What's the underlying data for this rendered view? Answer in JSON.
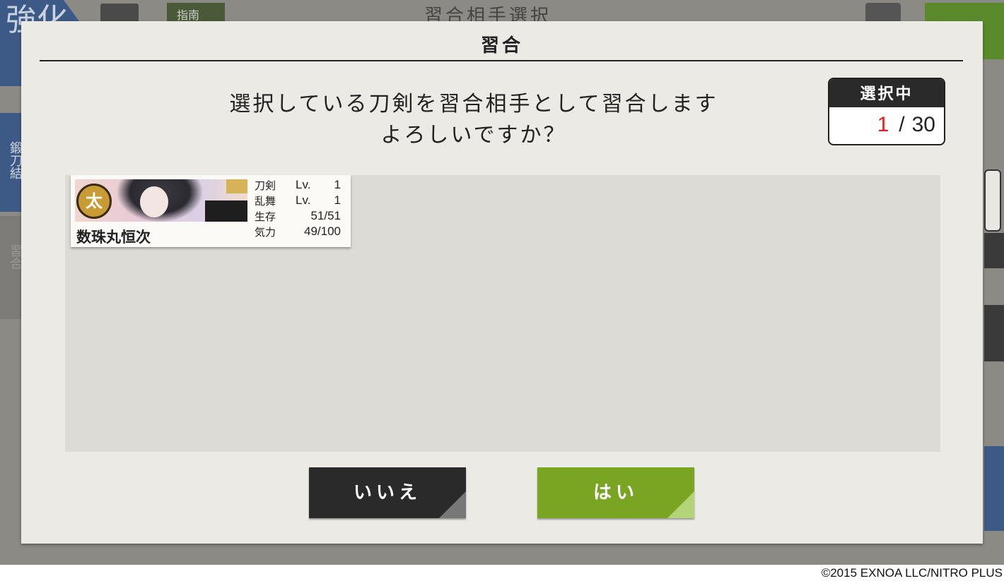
{
  "background": {
    "top_title": "習合相手選択",
    "guide_label": "指南",
    "left_badge_text": "強化",
    "side_tab_1": "鍛刀結",
    "side_tab_2": "習合"
  },
  "dialog": {
    "title": "習合",
    "message_line1": "選択している刀剣を習合相手として習合します",
    "message_line2": "よろしいですか？"
  },
  "selection_counter": {
    "header": "選択中",
    "current": "1",
    "separator": "/",
    "max": "30"
  },
  "sword_card": {
    "type_badge": "太",
    "name": "数珠丸恒次",
    "stats": [
      {
        "label": "刀剣",
        "prefix": "Lv.",
        "value": "1"
      },
      {
        "label": "乱舞",
        "prefix": "Lv.",
        "value": "1"
      },
      {
        "label": "生存",
        "prefix": "",
        "value": "51/51"
      },
      {
        "label": "気力",
        "prefix": "",
        "value": "49/100"
      }
    ]
  },
  "buttons": {
    "no_label": "いいえ",
    "yes_label": "はい"
  },
  "colors": {
    "yes_button": "#79a523",
    "no_button": "#2a2a2a",
    "counter_current": "#e02020"
  },
  "copyright": "©2015 EXNOA LLC/NITRO PLUS"
}
